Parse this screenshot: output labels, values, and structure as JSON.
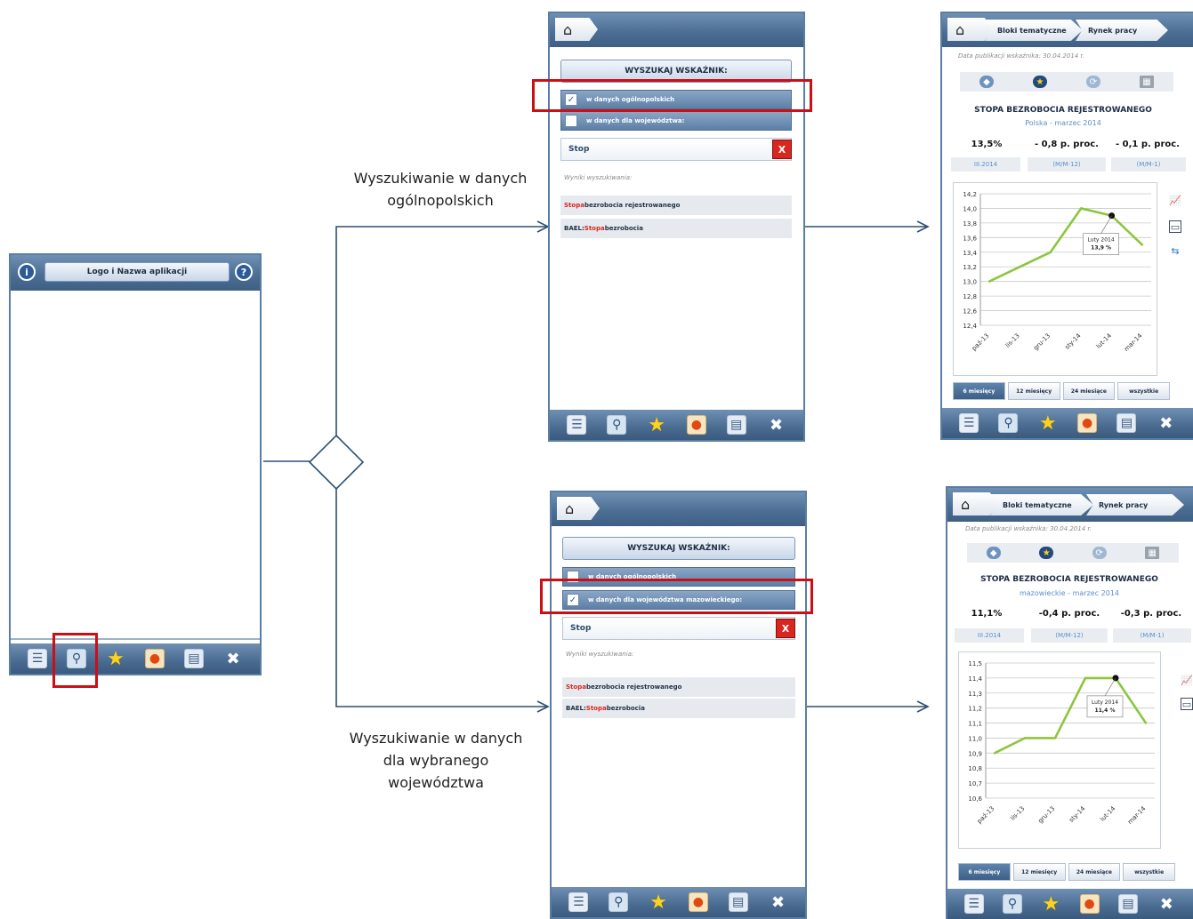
{
  "captions": {
    "national_line1": "Wyszukiwanie w danych",
    "national_line2": "ogólnopolskich",
    "regional_line1": "Wyszukiwanie w danych",
    "regional_line2": "dla wybranego",
    "regional_line3": "województwa"
  },
  "main_app": {
    "title": "Logo i Nazwa aplikacji",
    "info_icon": "i",
    "help_icon": "?"
  },
  "toolbar_icons": [
    "list-icon",
    "search-icon",
    "star-icon",
    "map-icon",
    "book-icon",
    "tools-icon"
  ],
  "search_national": {
    "header": "WYSZUKAJ WSKAŹNIK:",
    "option_national": "w danych ogólnopolskich",
    "option_regional": "w danych dla województwa:",
    "query": "Stop",
    "clear_label": "X",
    "results_label": "Wyniki wyszukiwania:",
    "results": [
      {
        "highlight": "Stopa",
        "rest": " bezrobocia rejestrowanego",
        "prefix": ""
      },
      {
        "highlight": "Stopa",
        "rest": " bezrobocia",
        "prefix": "BAEL: "
      }
    ]
  },
  "search_regional": {
    "header": "WYSZUKAJ WSKAŹNIK:",
    "option_national": "w danych ogólnopolskich",
    "option_regional": "w danych dla województwa mazowieckiego:",
    "query": "Stop",
    "clear_label": "X",
    "results_label": "Wyniki wyszukiwania:",
    "results": [
      {
        "highlight": "Stopa",
        "rest": " bezrobocia rejestrowanego",
        "prefix": ""
      },
      {
        "highlight": "Stopa",
        "rest": " bezrobocia",
        "prefix": "BAEL: "
      }
    ]
  },
  "result_national": {
    "crumb_1": "Bloki tematyczne",
    "crumb_2": "Rynek pracy",
    "pub_date": "Data publikacji wskaźnika: 30.04.2014 r.",
    "title": "STOPA BEZROBOCIA REJESTROWANEGO",
    "subtitle": "Polska - marzec 2014",
    "stat_1": "13,5%",
    "stat_2": "- 0,8 p. proc.",
    "stat_3": "- 0,1 p. proc.",
    "stat_1_sub": "III.2014",
    "stat_2_sub": "(M/M-12)",
    "stat_3_sub": "(M/M-1)",
    "tooltip_line1": "Luty 2014",
    "tooltip_line2": "13,9 %",
    "ranges": [
      "6 miesięcy",
      "12 miesięcy",
      "24 miesiące",
      "wszystkie"
    ]
  },
  "result_regional": {
    "crumb_1": "Bloki tematyczne",
    "crumb_2": "Rynek pracy",
    "pub_date": "Data publikacji wskaźnika: 30.04.2014 r.",
    "title": "STOPA BEZROBOCIA REJESTROWANEGO",
    "subtitle": "mazowieckie - marzec 2014",
    "stat_1": "11,1%",
    "stat_2": "-0,4 p. proc.",
    "stat_3": "-0,3 p. proc.",
    "stat_1_sub": "III.2014",
    "stat_2_sub": "(M/M-12)",
    "stat_3_sub": "(M/M-1)",
    "tooltip_line1": "Luty 2014",
    "tooltip_line2": "11,4 %",
    "ranges": [
      "6 miesięcy",
      "12 miesięcy",
      "24 miesiące",
      "wszystkie"
    ]
  },
  "chart_data": [
    {
      "type": "line",
      "categories": [
        "paź-13",
        "lis-13",
        "gru-13",
        "sty-14",
        "lut-14",
        "mar-14"
      ],
      "series": [
        {
          "values": [
            13.0,
            13.2,
            13.4,
            14.0,
            13.9,
            13.5
          ]
        }
      ],
      "yticks": [
        "14,2",
        "14,0",
        "13,8",
        "13,6",
        "13,4",
        "13,2",
        "13,0",
        "12,8",
        "12,6",
        "12,4"
      ],
      "ylim": [
        12.4,
        14.2
      ],
      "grid": true,
      "line_color": "#8cc63e",
      "highlight_index": 4
    },
    {
      "type": "line",
      "categories": [
        "paź-13",
        "lis-13",
        "gru-13",
        "sty-14",
        "lut-14",
        "mar-14"
      ],
      "series": [
        {
          "values": [
            10.9,
            11.0,
            11.0,
            11.4,
            11.4,
            11.1
          ]
        }
      ],
      "yticks": [
        "11,5",
        "11,4",
        "11,3",
        "11,2",
        "11,1",
        "11,0",
        "10,9",
        "10,8",
        "10,7",
        "10,6"
      ],
      "ylim": [
        10.6,
        11.5
      ],
      "grid": true,
      "line_color": "#8cc63e",
      "highlight_index": 4
    }
  ]
}
